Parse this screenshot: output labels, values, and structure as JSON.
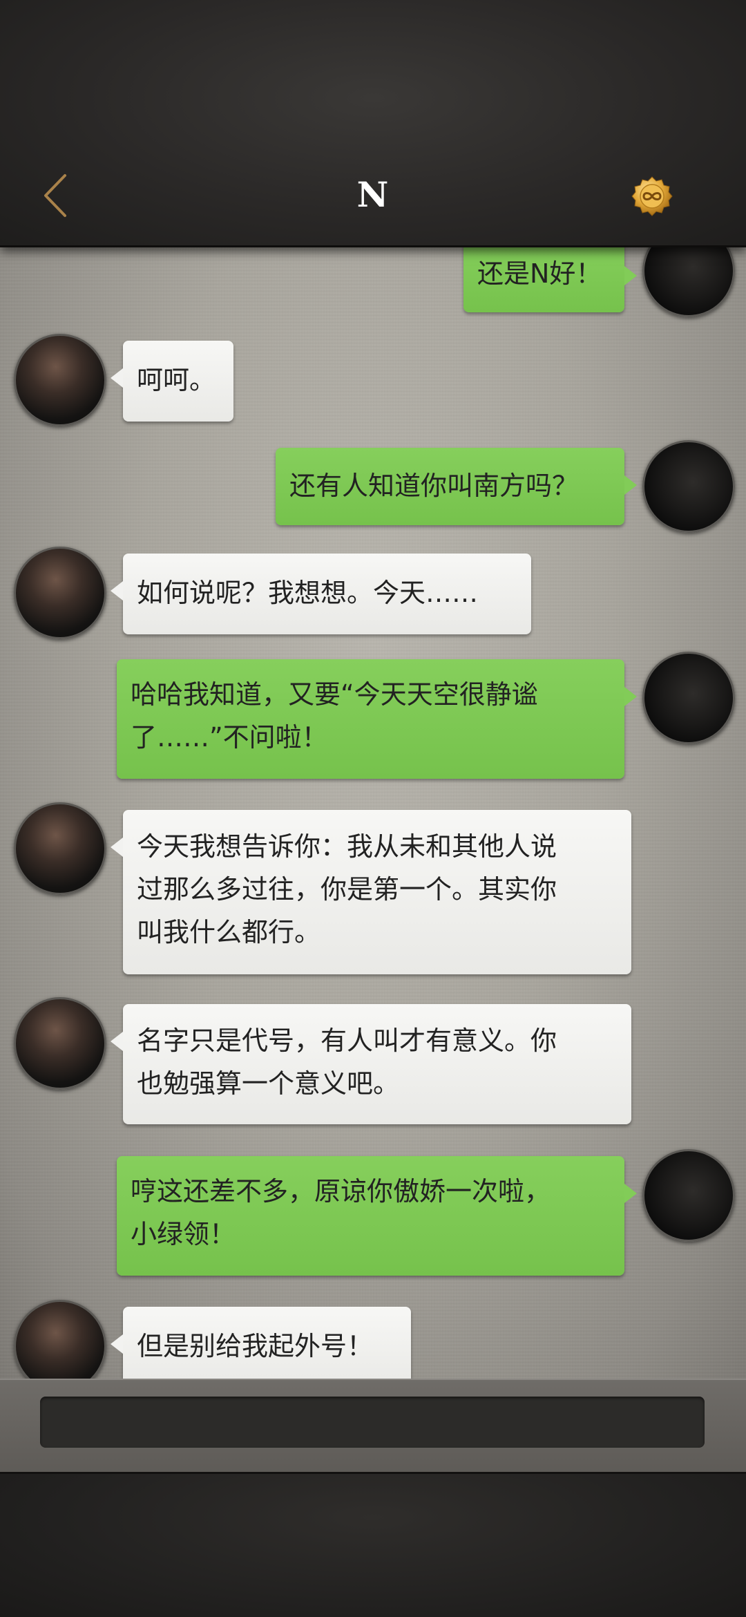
{
  "header": {
    "title": "N",
    "back_icon": "chevron-left-icon",
    "coin_icon": "gold-infinity-coin-icon",
    "accent_color": "#b08a4e"
  },
  "messages": [
    {
      "side": "right",
      "text": "还是N好！"
    },
    {
      "side": "left",
      "text": "呵呵。"
    },
    {
      "side": "right",
      "text": "还有人知道你叫南方吗？"
    },
    {
      "side": "left",
      "text": "如何说呢？我想想。今天……"
    },
    {
      "side": "right",
      "text": "哈哈我知道，又要“今天天空很静谧\n了……”不问啦！"
    },
    {
      "side": "left",
      "text": "今天我想告诉你：我从未和其他人说\n过那么多过往，你是第一个。其实你\n叫我什么都行。"
    },
    {
      "side": "left",
      "text": "名字只是代号，有人叫才有意义。你\n也勉强算一个意义吧。"
    },
    {
      "side": "right",
      "text": "哼这还差不多，原谅你傲娇一次啦，\n小绿领！"
    },
    {
      "side": "left",
      "text": "但是别给我起外号！"
    }
  ],
  "composer": {
    "value": "",
    "placeholder": ""
  },
  "colors": {
    "outgoing_bubble": "#7fc954",
    "incoming_bubble": "#f1f1ef"
  }
}
